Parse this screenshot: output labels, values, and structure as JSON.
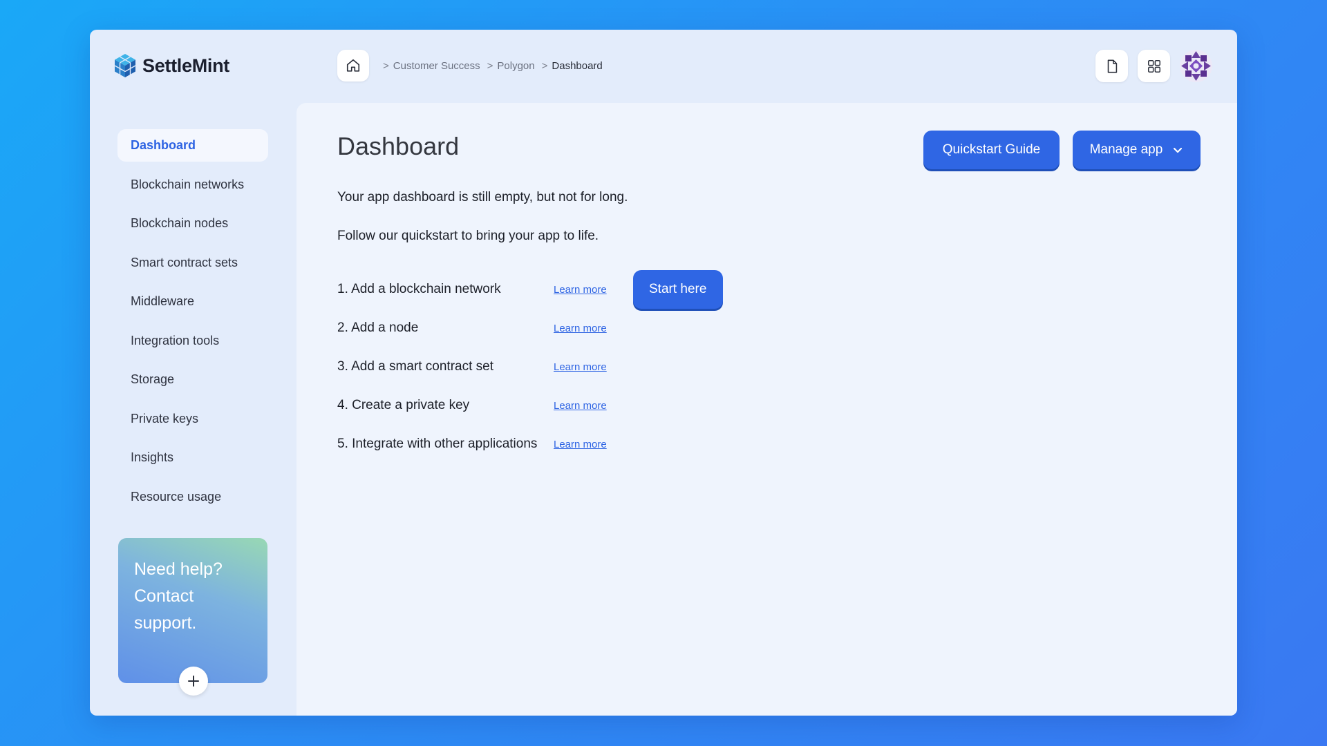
{
  "brand": {
    "name": "SettleMint"
  },
  "breadcrumb": {
    "items": [
      "Customer Success",
      "Polygon",
      "Dashboard"
    ],
    "separator": ">"
  },
  "sidebar": {
    "items": [
      {
        "label": "Dashboard",
        "active": true
      },
      {
        "label": "Blockchain networks"
      },
      {
        "label": "Blockchain nodes"
      },
      {
        "label": "Smart contract sets"
      },
      {
        "label": "Middleware"
      },
      {
        "label": "Integration tools"
      },
      {
        "label": "Storage"
      },
      {
        "label": "Private keys"
      },
      {
        "label": "Insights"
      },
      {
        "label": "Resource usage"
      }
    ],
    "help": {
      "line1": "Need help?",
      "line2": "Contact",
      "line3": "support."
    }
  },
  "main": {
    "title": "Dashboard",
    "quickstart_label": "Quickstart Guide",
    "manage_label": "Manage app",
    "intro1": "Your app dashboard is still empty, but not for long.",
    "intro2": "Follow our quickstart to bring your app to life.",
    "steps": [
      {
        "label": "1. Add a blockchain network",
        "link": "Learn more",
        "cta": "Start here"
      },
      {
        "label": "2. Add a node",
        "link": "Learn more"
      },
      {
        "label": "3. Add a smart contract set",
        "link": "Learn more"
      },
      {
        "label": "4. Create a private key",
        "link": "Learn more"
      },
      {
        "label": "5. Integrate with other applications",
        "link": "Learn more"
      }
    ]
  },
  "icons": [
    "home-icon",
    "document-icon",
    "grid-icon",
    "avatar",
    "chevron-down-icon",
    "plus-icon",
    "settlemint-logo-icon"
  ],
  "colors": {
    "accent": "#2f66e4",
    "background_gradient_start": "#1aa8f7",
    "background_gradient_end": "#3a78f2",
    "active_nav": "#2d63e3"
  }
}
